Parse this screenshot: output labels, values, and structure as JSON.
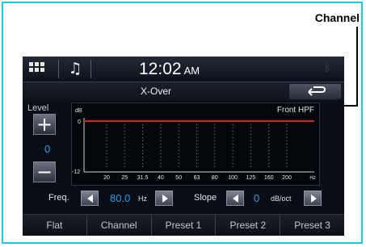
{
  "callout": {
    "label": "Channel"
  },
  "statusbar": {
    "time": "12:02",
    "ampm": "AM",
    "bluetooth_icon": "bluetooth-icon"
  },
  "titlebar": {
    "title": "X-Over"
  },
  "level": {
    "label": "Level",
    "value": "0"
  },
  "graph": {
    "channel_label": "Front HPF",
    "unit_label": "dB",
    "y_top": "0",
    "y_bottom": "-12",
    "hz_label": "Hz",
    "freq_ticks": [
      "20",
      "25",
      "31.5",
      "40",
      "50",
      "63",
      "80",
      "100",
      "125",
      "160",
      "200"
    ],
    "curve_color": "#e01e1e"
  },
  "freq": {
    "label": "Freq.",
    "value": "80.0",
    "unit": "Hz"
  },
  "slope": {
    "label": "Slope",
    "value": "0",
    "unit": "dB/oct"
  },
  "presets": [
    "Flat",
    "Channel",
    "Preset 1",
    "Preset 2",
    "Preset 3"
  ],
  "colors": {
    "accent_value": "#2f9be8",
    "frame": "#1fc8e3"
  }
}
